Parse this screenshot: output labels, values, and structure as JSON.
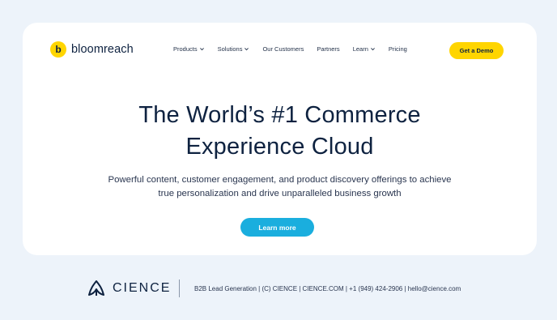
{
  "header": {
    "logo_letter": "b",
    "logo_text": "bloomreach",
    "nav": [
      {
        "label": "Products",
        "has_dropdown": true,
        "icon": "chevron-down-icon"
      },
      {
        "label": "Solutions",
        "has_dropdown": true,
        "icon": "chevron-down-icon"
      },
      {
        "label": "Our Customers",
        "has_dropdown": false
      },
      {
        "label": "Partners",
        "has_dropdown": false
      },
      {
        "label": "Learn",
        "has_dropdown": true,
        "icon": "chevron-down-icon"
      },
      {
        "label": "Pricing",
        "has_dropdown": false
      }
    ],
    "cta_label": "Get a Demo"
  },
  "hero": {
    "title_line1": "The World’s #1 Commerce",
    "title_line2": "Experience Cloud",
    "subtitle_line1": "Powerful content, customer engagement, and product discovery offerings to achieve",
    "subtitle_line2": "true personalization and drive unparalleled business growth",
    "button_label": "Learn more"
  },
  "footer": {
    "brand": "CIENCE",
    "brand_icon": "cience-logo-icon",
    "info": "B2B Lead Generation | (C) CIENCE | CIENCE.COM | +1 (949) 424-2906 | hello@cience.com"
  },
  "colors": {
    "background": "#edf3fa",
    "card": "#ffffff",
    "brand_yellow": "#ffd500",
    "accent_blue": "#1aaede",
    "text_dark": "#0e2240"
  }
}
